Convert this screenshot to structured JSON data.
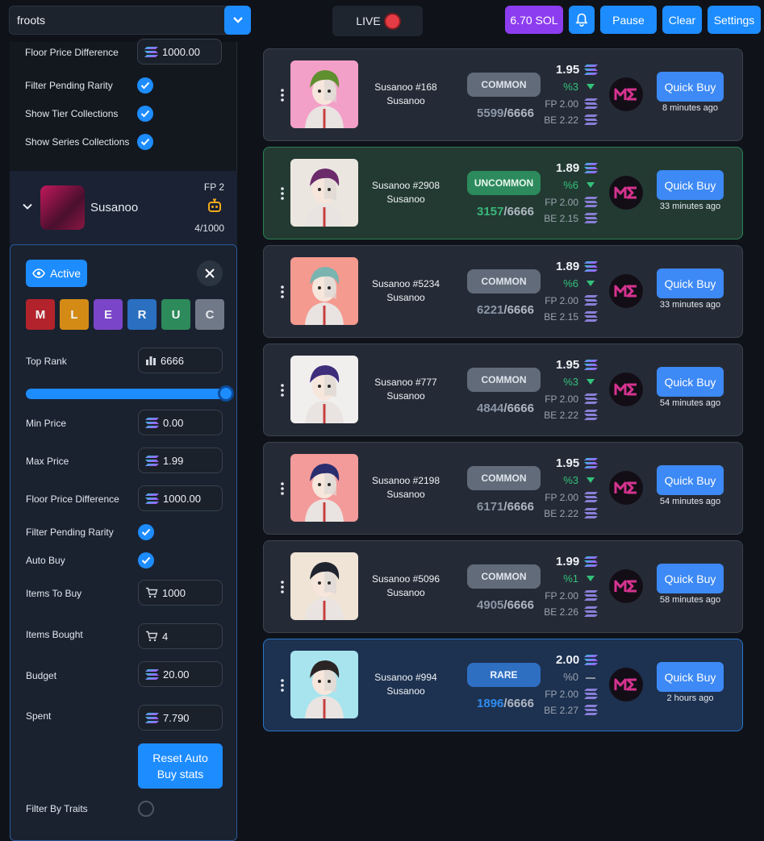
{
  "header": {
    "search_value": "froots",
    "live_label": "LIVE",
    "balance_label": "6.70 SOL",
    "pause_label": "Pause",
    "clear_label": "Clear",
    "settings_label": "Settings"
  },
  "sidebar_top": {
    "floor_diff_label": "Floor Price Difference",
    "floor_diff_value": "1000.00",
    "filter_pending_label": "Filter Pending Rarity",
    "show_tier_label": "Show Tier Collections",
    "show_series_label": "Show Series Collections"
  },
  "collection": {
    "name": "Susanoo",
    "fp_label": "FP 2",
    "count_label": "4/1000"
  },
  "panel": {
    "active_label": "Active",
    "rarities": [
      {
        "letter": "M",
        "color": "#b3232b"
      },
      {
        "letter": "L",
        "color": "#d38b16"
      },
      {
        "letter": "E",
        "color": "#7a45c8"
      },
      {
        "letter": "R",
        "color": "#2a6fc0"
      },
      {
        "letter": "U",
        "color": "#2d8a5a"
      },
      {
        "letter": "C",
        "color": "#707987"
      }
    ],
    "top_rank_label": "Top Rank",
    "top_rank_value": "6666",
    "top_rank_slider_fraction": 1.0,
    "min_price_label": "Min Price",
    "min_price_value": "0.00",
    "max_price_label": "Max Price",
    "max_price_value": "1.99",
    "floor_diff_label": "Floor Price Difference",
    "floor_diff_value": "1000.00",
    "filter_pending_label": "Filter Pending Rarity",
    "auto_buy_label": "Auto Buy",
    "items_to_buy_label": "Items To Buy",
    "items_to_buy_value": "1000",
    "items_bought_label": "Items Bought",
    "items_bought_value": "4",
    "budget_label": "Budget",
    "budget_value": "20.00",
    "spent_label": "Spent",
    "spent_value": "7.790",
    "reset_line1": "Reset Auto",
    "reset_line2": "Buy stats",
    "filter_traits_label": "Filter By Traits"
  },
  "listings": [
    {
      "name": "Susanoo #168",
      "collection": "Susanoo",
      "rarity": "COMMON",
      "rank": "5599",
      "supply": "/6666",
      "price": "1.95",
      "pct": "%3",
      "trend": "down",
      "fp": "FP 2.00",
      "be": "BE 2.22",
      "ago": "8 minutes ago",
      "buy_label": "Quick Buy",
      "thumb_bg": "#f3a0c8",
      "hair": "#5f8f2f",
      "type": "common"
    },
    {
      "name": "Susanoo #2908",
      "collection": "Susanoo",
      "rarity": "UNCOMMON",
      "rank": "3157",
      "supply": "/6666",
      "price": "1.89",
      "pct": "%6",
      "trend": "down",
      "fp": "FP 2.00",
      "be": "BE 2.15",
      "ago": "33 minutes ago",
      "buy_label": "Quick Buy",
      "thumb_bg": "#ebe7e0",
      "hair": "#6b2a6a",
      "type": "unc"
    },
    {
      "name": "Susanoo #5234",
      "collection": "Susanoo",
      "rarity": "COMMON",
      "rank": "6221",
      "supply": "/6666",
      "price": "1.89",
      "pct": "%6",
      "trend": "down",
      "fp": "FP 2.00",
      "be": "BE 2.15",
      "ago": "33 minutes ago",
      "buy_label": "Quick Buy",
      "thumb_bg": "#f59a8f",
      "hair": "#79b4b0",
      "type": "common"
    },
    {
      "name": "Susanoo #777",
      "collection": "Susanoo",
      "rarity": "COMMON",
      "rank": "4844",
      "supply": "/6666",
      "price": "1.95",
      "pct": "%3",
      "trend": "down",
      "fp": "FP 2.00",
      "be": "BE 2.22",
      "ago": "54 minutes ago",
      "buy_label": "Quick Buy",
      "thumb_bg": "#f1eeee",
      "hair": "#3d2d7a",
      "type": "common"
    },
    {
      "name": "Susanoo #2198",
      "collection": "Susanoo",
      "rarity": "COMMON",
      "rank": "6171",
      "supply": "/6666",
      "price": "1.95",
      "pct": "%3",
      "trend": "down",
      "fp": "FP 2.00",
      "be": "BE 2.22",
      "ago": "54 minutes ago",
      "buy_label": "Quick Buy",
      "thumb_bg": "#f39b9a",
      "hair": "#2a2d6e",
      "type": "common"
    },
    {
      "name": "Susanoo #5096",
      "collection": "Susanoo",
      "rarity": "COMMON",
      "rank": "4905",
      "supply": "/6666",
      "price": "1.99",
      "pct": "%1",
      "trend": "down",
      "fp": "FP 2.00",
      "be": "BE 2.26",
      "ago": "58 minutes ago",
      "buy_label": "Quick Buy",
      "thumb_bg": "#efe4d6",
      "hair": "#20242f",
      "type": "common"
    },
    {
      "name": "Susanoo #994",
      "collection": "Susanoo",
      "rarity": "RARE",
      "rank": "1896",
      "supply": "/6666",
      "price": "2.00",
      "pct": "%0",
      "trend": "flat",
      "fp": "FP 2.00",
      "be": "BE 2.27",
      "ago": "2 hours ago",
      "buy_label": "Quick Buy",
      "thumb_bg": "#a8e4ee",
      "hair": "#2b2424",
      "type": "rare"
    }
  ]
}
